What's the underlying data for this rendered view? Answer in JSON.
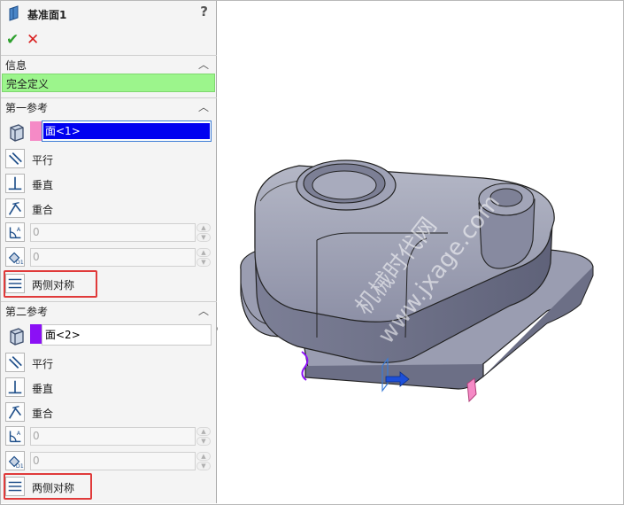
{
  "panel": {
    "title": "基准面1",
    "help": "?",
    "ok": "✔",
    "cancel": "✕",
    "info": {
      "header": "信息",
      "status": "完全定义"
    },
    "first_ref": {
      "header": "第一参考",
      "selection": "面<1>",
      "chip_color": "#f58ac6",
      "options": [
        "平行",
        "垂直",
        "重合"
      ],
      "angle_value": "0",
      "distance_value": "0",
      "symmetric_label": "两侧对称"
    },
    "second_ref": {
      "header": "第二参考",
      "selection": "面<2>",
      "chip_color": "#8b10f5",
      "options": [
        "平行",
        "垂直",
        "重合"
      ],
      "angle_value": "0",
      "distance_value": "0",
      "symmetric_label": "两侧对称"
    }
  },
  "viewport": {
    "watermark_line1": "机械时代网",
    "watermark_line2": "www.jxage.com",
    "model_color": "#8c8fa6",
    "highlight_box_color": "#e03a3a"
  }
}
